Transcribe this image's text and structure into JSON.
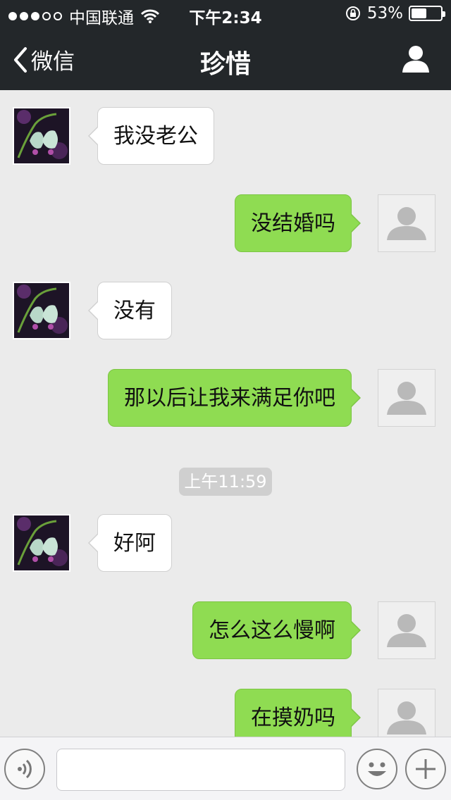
{
  "status_bar": {
    "carrier": "中国联通",
    "time": "下午2:34",
    "battery_text": "53%",
    "battery_level": 0.53,
    "signal_dots": [
      true,
      true,
      true,
      false,
      false
    ]
  },
  "nav": {
    "back_label": "微信",
    "title": "珍惜"
  },
  "messages": [
    {
      "side": "in",
      "text": "我没老公"
    },
    {
      "side": "out",
      "text": "没结婚吗"
    },
    {
      "side": "in",
      "text": "没有"
    },
    {
      "side": "out",
      "text": "那以后让我来满足你吧"
    },
    {
      "side": "in",
      "text": "好阿"
    },
    {
      "side": "out",
      "text": "怎么这么慢啊"
    },
    {
      "side": "out",
      "text": "在摸奶吗"
    }
  ],
  "timestamp": "上午11:59",
  "input_bar": {
    "placeholder": ""
  },
  "colors": {
    "header_bg": "#23272a",
    "chat_bg": "#ebebeb",
    "outgoing_bubble": "#8fdc52",
    "incoming_bubble": "#ffffff"
  }
}
